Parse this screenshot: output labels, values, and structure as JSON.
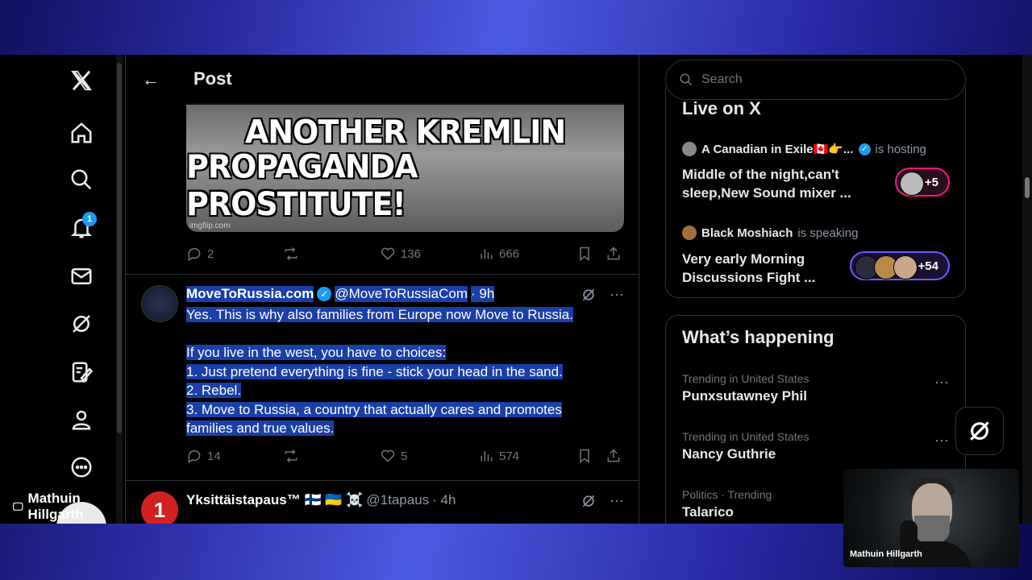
{
  "header": {
    "title": "Post"
  },
  "nav": {
    "notification_count": "1",
    "user_display": "Mathuin Hillgarth"
  },
  "meme": {
    "line1": "ANOTHER KREMLIN",
    "line2": "PROPAGANDA PROSTITUTE!",
    "watermark": "imgflip.com"
  },
  "post1_actions": {
    "replies": "2",
    "reposts": "",
    "likes": "136",
    "views": "666"
  },
  "tweet2": {
    "name": "MoveToRussia.com",
    "handle": "@MoveToRussiaCom",
    "time": "· 9h",
    "lines": [
      "Yes. This is why also families from Europe now Move to Russia.",
      "",
      "If you live in the west, you have to choices:",
      "1. Just pretend everything is fine - stick your head in the sand.",
      "2. Rebel.",
      "3. Move to Russia, a country that actually cares and promotes",
      "families and true values."
    ],
    "replies": "14",
    "likes": "5",
    "views": "574"
  },
  "tweet3": {
    "name": "Yksittäistapaus™ 🇫🇮 🇺🇦 ☠️",
    "handle": "@1tapaus",
    "time": "· 4h",
    "avatar_text": "1"
  },
  "search": {
    "placeholder": "Search"
  },
  "live": {
    "title": "Live on X",
    "items": [
      {
        "host": "A Canadian in Exile🇨🇦👉...",
        "status": "is hosting",
        "text": "Middle of the night,can't sleep,New Sound mixer ...",
        "count": "+5"
      },
      {
        "host": "Black Moshiach",
        "status": "is speaking",
        "text": "Very early Morning Discussions Fight ...",
        "count": "+54"
      }
    ]
  },
  "happening": {
    "title": "What’s happening",
    "trends": [
      {
        "context": "Trending in United States",
        "name": "Punxsutawney Phil"
      },
      {
        "context": "Trending in United States",
        "name": "Nancy Guthrie"
      },
      {
        "context": "Politics · Trending",
        "name": "Talarico"
      }
    ]
  },
  "webcam": {
    "caption": "Mathuin Hillgarth"
  },
  "colors": {
    "accent": "#1d9bf0",
    "selection": "#1a3fa8",
    "background": "#000000"
  }
}
